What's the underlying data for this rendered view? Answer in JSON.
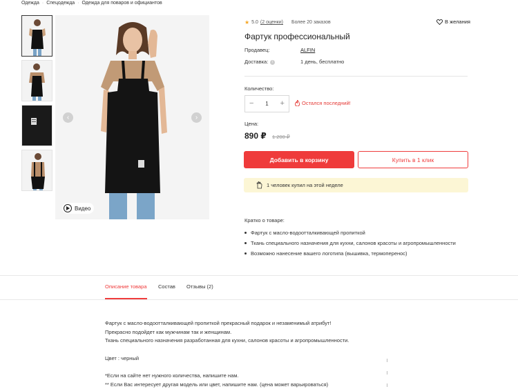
{
  "breadcrumb": [
    "Одежда",
    "Спецодежда",
    "Одежда для поваров и официантов"
  ],
  "gallery": {
    "thumb_count": 4,
    "video_label": "Видео",
    "prev_icon": "chevron-left-icon",
    "next_icon": "chevron-right-icon"
  },
  "rating": {
    "value": "5.0",
    "reviews": "(2 оценки)",
    "orders": "Более 20 заказов"
  },
  "wishlist_label": "В желания",
  "product": {
    "title": "Фартук профессиональный",
    "seller_label": "Продавец:",
    "seller_name": "ALFIN",
    "delivery_label": "Доставка:",
    "delivery_value": "1 день, бесплатно"
  },
  "quantity": {
    "label": "Количество:",
    "value": "1",
    "minus": "−",
    "plus": "+",
    "stock_note": "Остался последний!"
  },
  "price": {
    "label": "Цена:",
    "current": "890 ₽",
    "old": "1 200 ₽"
  },
  "buttons": {
    "add_to_cart": "Добавить в корзину",
    "buy_one_click": "Купить в 1 клик"
  },
  "bought_banner": "1 человек купил на этой неделе",
  "summary": {
    "title": "Кратко о товаре:",
    "items": [
      "Фартук с масло-водоотталкивающей пропиткой",
      "Ткань специального назначения для кухни, салонов красоты и агропромышленности",
      "Возможно нанесение вашего логотипа (вышивка, термоперенос)"
    ]
  },
  "tabs": [
    "Описание товара",
    "Состав",
    "Отзывы (2)"
  ],
  "description": {
    "lines": [
      "Фартук с масло-водоотталкивающей пропиткой прекрасный подарок и незаменимый атрибут!",
      "Прекрасно подойдет как мужчинам так и женщинам.",
      "Ткань специального назначения разработанная для кухни, салонов красоты и агропромышленности."
    ],
    "color": "Цвет : черный",
    "notes": [
      "*Если на сайте нет нужного количества, напишите нам.",
      "** Если Вас интересует другая модель или цвет, напишите нам. (цена может варьироваться)"
    ]
  },
  "colors": {
    "accent": "#ef3b3b",
    "banner": "#fcf6d5",
    "star": "#f5a623"
  }
}
